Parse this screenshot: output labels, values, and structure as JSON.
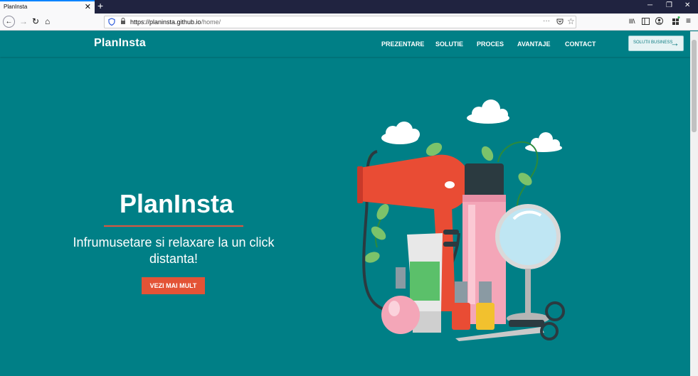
{
  "browser": {
    "tab_title": "PlanInsta",
    "tab_close": "✕",
    "new_tab": "+",
    "win_min": "─",
    "win_max": "❐",
    "win_close": "✕",
    "url_host": "https://planinsta.github.io",
    "url_path": "/home/",
    "back": "←",
    "forward": "→",
    "reload": "↻",
    "home": "⌂",
    "url_more": "···",
    "bookmark": "☆",
    "library": "lll\\",
    "menu": "≡"
  },
  "site": {
    "logo": "PlanInsta",
    "nav": [
      "PREZENTARE",
      "SOLUTIE",
      "PROCES",
      "AVANTAJE",
      "CONTACT"
    ],
    "cta": "SOLUTII BUSINESS",
    "cta_arrow": "→"
  },
  "hero": {
    "title": "PlanInsta",
    "subtitle": "Infrumusetare si relaxare la un click distanta!",
    "button": "VEZI MAI MULT"
  },
  "colors": {
    "background": "#007f86",
    "accent": "#e35336",
    "chrome_dark": "#202340"
  },
  "icons": {
    "illustration": "beauty-products-illustration"
  }
}
